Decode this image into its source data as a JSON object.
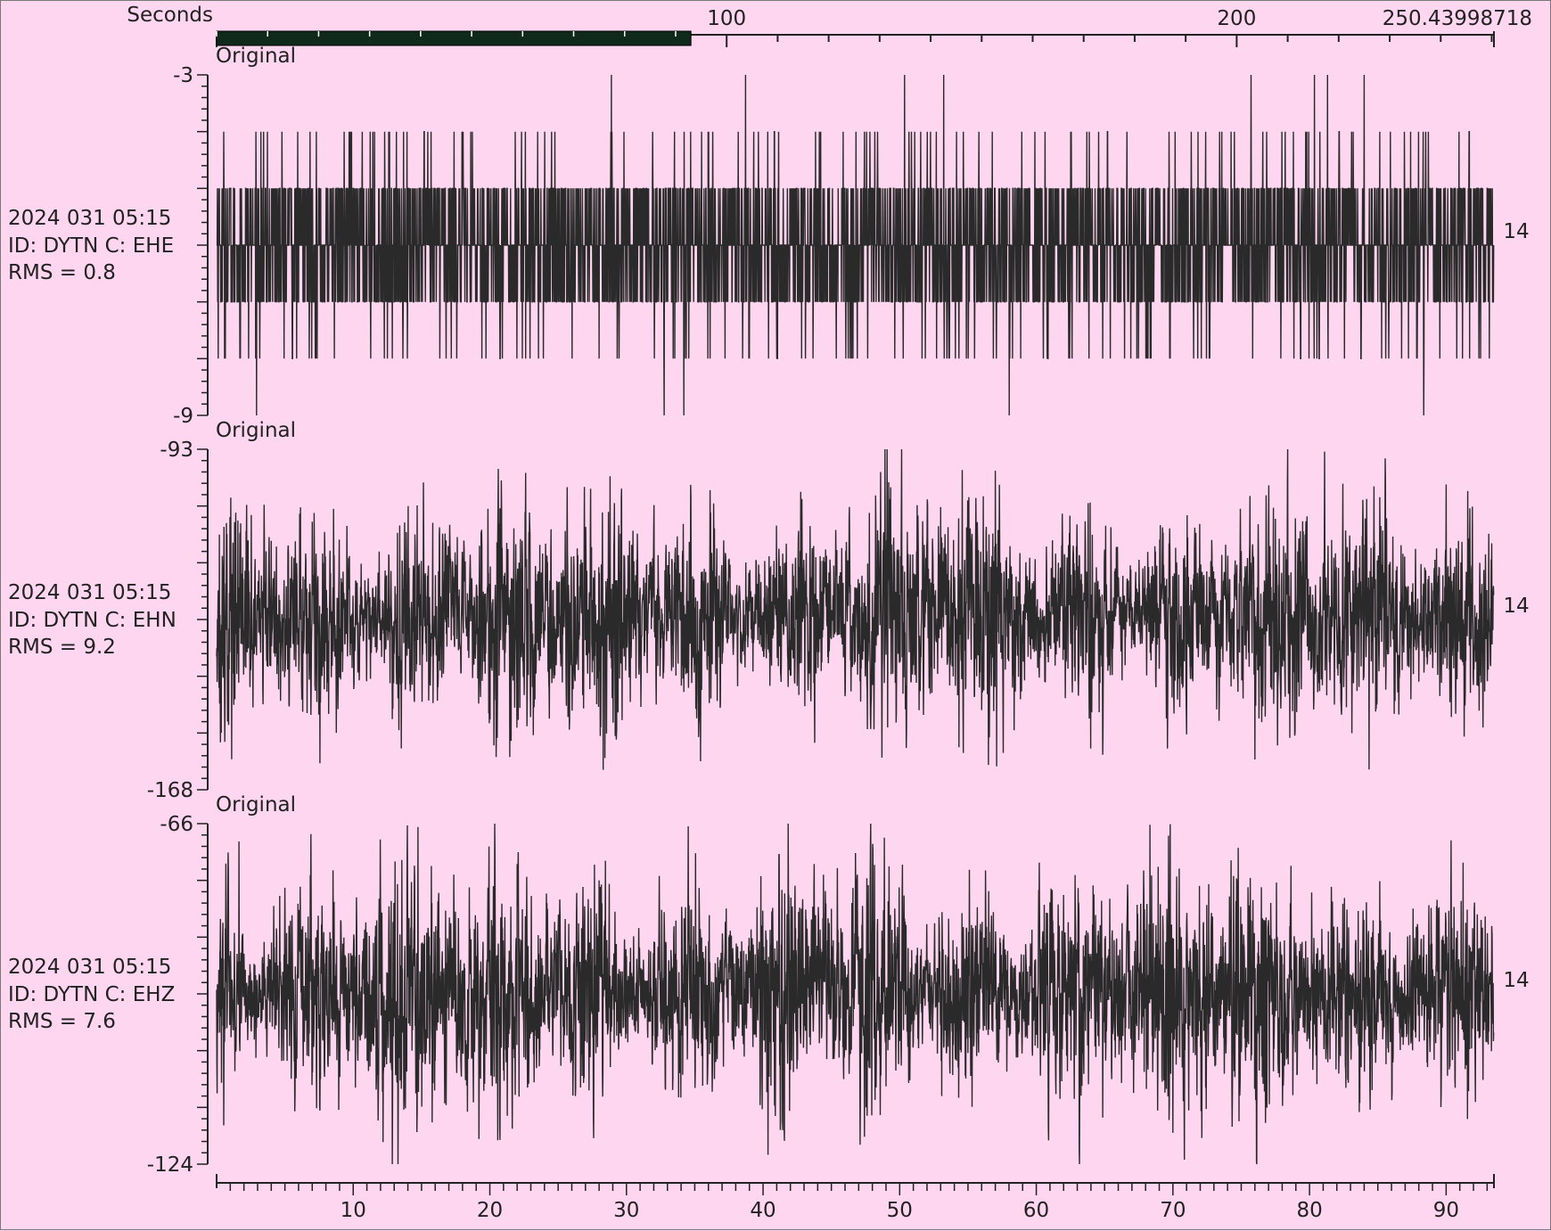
{
  "topbar": {
    "axis_title": "Seconds",
    "tick_values": [
      100,
      200
    ],
    "tick_labels": [
      "100",
      "200"
    ],
    "end_value": 250.43998718,
    "end_label": "250.43998718",
    "visible_window": [
      0,
      93
    ]
  },
  "chart_data": {
    "type": "line",
    "xlim": [
      0,
      93.5
    ],
    "x_tick_values": [
      10,
      20,
      30,
      40,
      50,
      60,
      70,
      80,
      90
    ],
    "x_tick_labels": [
      "10",
      "20",
      "30",
      "40",
      "50",
      "60",
      "70",
      "80",
      "90"
    ],
    "sample_rate_hz": 50,
    "grid": false,
    "traces": [
      {
        "tag": "Original",
        "date_label": "2024 031 05:15",
        "id_label": "ID: DYTN C: EHE",
        "rms_label": "RMS = 0.8",
        "right_label": "14",
        "ylim": [
          -9,
          -3
        ],
        "y_top_label": "-3",
        "y_bottom_label": "-9",
        "baseline": -6,
        "rms": 0.8,
        "discrete": true,
        "color": "#2a2a2a"
      },
      {
        "tag": "Original",
        "date_label": "2024 031 05:15",
        "id_label": "ID: DYTN C: EHN",
        "rms_label": "RMS = 9.2",
        "right_label": "14",
        "ylim": [
          -168,
          -93
        ],
        "y_top_label": "-93",
        "y_bottom_label": "-168",
        "baseline": -130,
        "rms": 9.2,
        "discrete": false,
        "color": "#2a2a2a"
      },
      {
        "tag": "Original",
        "date_label": "2024 031 05:15",
        "id_label": "ID: DYTN C: EHZ",
        "rms_label": "RMS = 7.6",
        "right_label": "14",
        "ylim": [
          -124,
          -66
        ],
        "y_top_label": "-66",
        "y_bottom_label": "-124",
        "baseline": -95,
        "rms": 7.6,
        "discrete": false,
        "color": "#2a2a2a"
      }
    ]
  },
  "colors": {
    "background": "#ffd6f0",
    "trace": "#2a2a2a",
    "window_bar": "#0f2a1a"
  }
}
